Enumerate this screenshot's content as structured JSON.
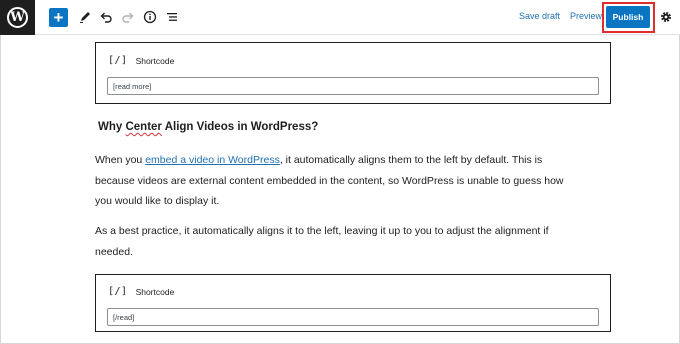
{
  "toolbar": {
    "logo_letter": "W",
    "add_label": "+",
    "save_draft_label": "Save draft",
    "preview_label": "Preview",
    "publish_label": "Publish",
    "icons": [
      "wordpress-logo-icon",
      "plus-icon",
      "pencil-icon",
      "undo-icon",
      "redo-icon",
      "info-icon",
      "list-view-icon",
      "gear-icon"
    ]
  },
  "blocks": {
    "shortcode1": {
      "icon": "[/]",
      "label": "Shortcode",
      "value": "[read more]"
    },
    "shortcode2": {
      "icon": "[/]",
      "label": "Shortcode",
      "value": "[/read]"
    }
  },
  "content": {
    "heading_pre": "Why ",
    "heading_center": "Center",
    "heading_post": " Align Videos in WordPress?",
    "para1": {
      "line1_pre": "When you ",
      "line1_link": "embed a video in WordPress",
      "line1_post": ", it automatically aligns them to the left by default. This is",
      "line2": "because videos are external content embedded in the content, so WordPress is unable to guess how",
      "line3": "you would like to display it."
    },
    "para2": {
      "line1": "As a best practice, it automatically aligns it to the left, leaving it up to you to adjust the alignment if",
      "line2": "needed."
    }
  },
  "colors": {
    "accent": "#0a75c2",
    "link": "#2271b1",
    "highlight": "#e02d2d",
    "logo_bg": "#1e1e1e"
  }
}
